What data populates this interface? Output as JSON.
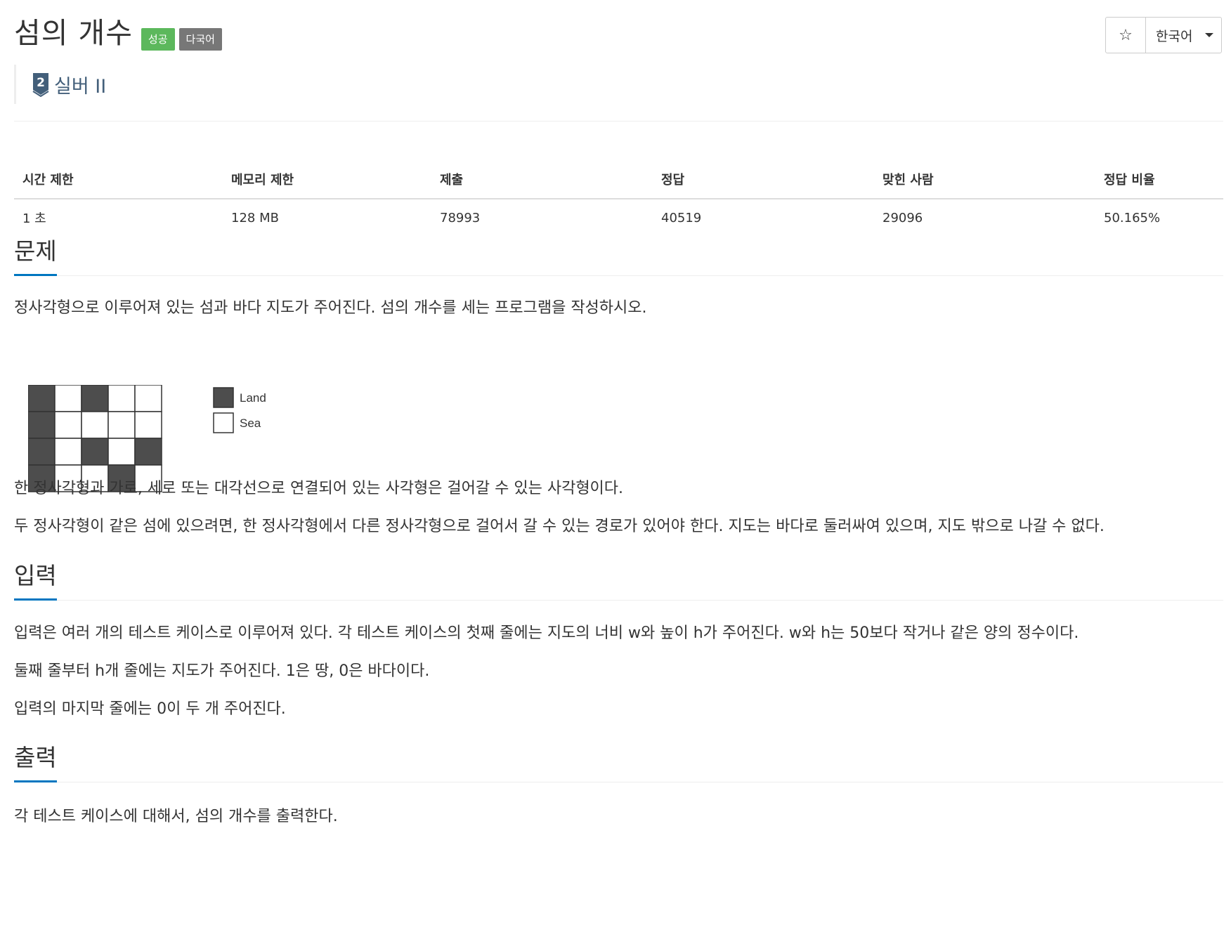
{
  "header": {
    "title": "섬의 개수",
    "badge_success": "성공",
    "badge_multilang": "다국어",
    "tier_number": "2",
    "tier_label": "실버 II",
    "star_icon": "star-outline-icon",
    "language": "한국어"
  },
  "info_table": {
    "headers": [
      "시간 제한",
      "메모리 제한",
      "제출",
      "정답",
      "맞힌 사람",
      "정답 비율"
    ],
    "values": [
      "1 초",
      "128 MB",
      "78993",
      "40519",
      "29096",
      "50.165%"
    ]
  },
  "problem": {
    "heading": "문제",
    "p1": "정사각형으로 이루어져 있는 섬과 바다 지도가 주어진다. 섬의 개수를 세는 프로그램을 작성하시오.",
    "figure": {
      "grid": [
        [
          1,
          0,
          1,
          0,
          0
        ],
        [
          1,
          0,
          0,
          0,
          0
        ],
        [
          1,
          0,
          1,
          0,
          1
        ],
        [
          1,
          0,
          0,
          1,
          0
        ]
      ],
      "legend_land": "Land",
      "legend_sea": "Sea",
      "land_color": "#4d4d4d",
      "sea_color": "#ffffff"
    },
    "p2": "한 정사각형과 가로, 세로 또는 대각선으로 연결되어 있는 사각형은 걸어갈 수 있는 사각형이다.",
    "p3": "두 정사각형이 같은 섬에 있으려면, 한 정사각형에서 다른 정사각형으로 걸어서 갈 수 있는 경로가 있어야 한다. 지도는 바다로 둘러싸여 있으며, 지도 밖으로 나갈 수 없다."
  },
  "input": {
    "heading": "입력",
    "p1": "입력은 여러 개의 테스트 케이스로 이루어져 있다. 각 테스트 케이스의 첫째 줄에는 지도의 너비 w와 높이 h가 주어진다. w와 h는 50보다 작거나 같은 양의 정수이다.",
    "p2": "둘째 줄부터 h개 줄에는 지도가 주어진다. 1은 땅, 0은 바다이다.",
    "p3": "입력의 마지막 줄에는 0이 두 개 주어진다."
  },
  "output": {
    "heading": "출력",
    "p1": "각 테스트 케이스에 대해서, 섬의 개수를 출력한다."
  },
  "colors": {
    "accent": "#0076c0",
    "success": "#5cb85c",
    "default_badge": "#777777",
    "tier_silver": "#435f7a"
  }
}
